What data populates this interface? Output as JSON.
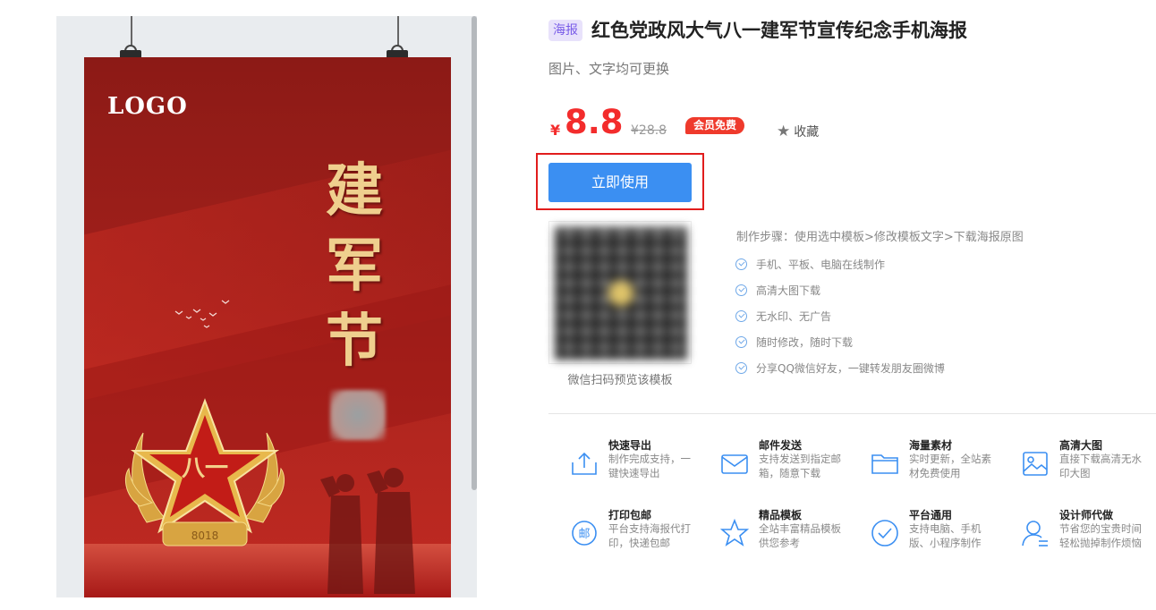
{
  "poster": {
    "logo_text": "LOGO",
    "vertical_title": "建军节",
    "emblem_text": "八一",
    "base_text": "8018"
  },
  "product": {
    "tag": "海报",
    "title": "红色党政风大气八一建军节宣传纪念手机海报",
    "subtitle": "图片、文字均可更换",
    "currency": "¥",
    "price": "8.8",
    "original_price": "¥28.8",
    "member_badge": "会员免费",
    "favorite_label": "收藏",
    "use_button": "立即使用",
    "qr_caption": "微信扫码预览该模板"
  },
  "steps_text": "制作步骤：使用选中模板>修改模板文字>下载海报原图",
  "features": [
    "手机、平板、电脑在线制作",
    "高清大图下载",
    "无水印、无广告",
    "随时修改，随时下载",
    "分享QQ微信好友，一键转发朋友圈微博"
  ],
  "services": [
    {
      "name": "快速导出",
      "desc": "制作完成支持，一键快速导出",
      "icon": "export-icon"
    },
    {
      "name": "邮件发送",
      "desc": "支持发送到指定邮箱，随意下载",
      "icon": "mail-icon"
    },
    {
      "name": "海量素材",
      "desc": "实时更新，全站素材免费使用",
      "icon": "folder-icon"
    },
    {
      "name": "高清大图",
      "desc": "直接下载高清无水印大图",
      "icon": "image-icon"
    },
    {
      "name": "打印包邮",
      "desc": "平台支持海报代打印，快递包邮",
      "icon": "mail-stamp-icon"
    },
    {
      "name": "精品模板",
      "desc": "全站丰富精品模板供您参考",
      "icon": "star-icon"
    },
    {
      "name": "平台通用",
      "desc": "支持电脑、手机版、小程序制作",
      "icon": "check-circle-icon"
    },
    {
      "name": "设计师代做",
      "desc": "节省您的宝贵时间轻松抛掉制作烦恼",
      "icon": "designer-icon"
    }
  ],
  "colors": {
    "accent_blue": "#3b8ff2",
    "price_red": "#f32c2c",
    "highlight_red": "#e11d1d",
    "poster_red": "#a3201b",
    "gold": "#efcf8e"
  }
}
